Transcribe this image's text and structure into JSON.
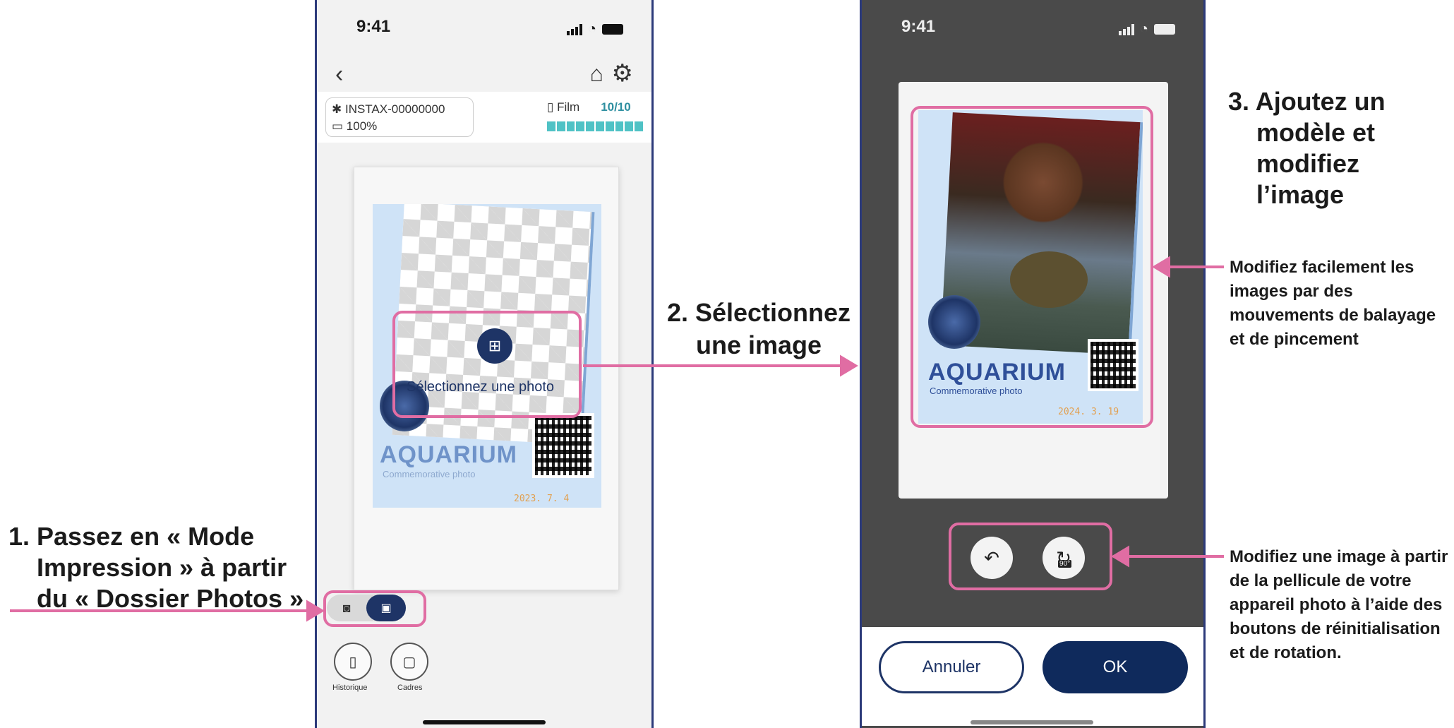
{
  "callouts": {
    "step1": [
      "1. Passez en « Mode",
      "Impression » à partir",
      "du « Dossier Photos »"
    ],
    "step2": [
      "2. Sélectionnez",
      "une image"
    ],
    "step3": [
      "3. Ajoutez un",
      "modèle et",
      "modifiez",
      "l’image"
    ],
    "note_swipe": "Modifiez facilement les images par des mouvements de balayage et de pincement",
    "note_buttons": "Modifiez une image à partir de la pellicule de votre appareil photo à l’aide des boutons de réinitialisation et de rotation."
  },
  "phone1": {
    "time": "9:41",
    "device_name": "INSTAX-00000000",
    "battery": "100%",
    "film_label": "Film",
    "film_count": "10/10",
    "select_photo": "Sélectionnez une photo",
    "template_title": "AQUARIUM",
    "template_subtitle": "Commemorative photo",
    "template_date": "2023. 7. 4",
    "history_label": "Historique",
    "frames_label": "Cadres",
    "icons": [
      "back-chevron-icon",
      "home-icon",
      "gear-icon",
      "bluetooth-icon",
      "battery-icon",
      "film-icon",
      "add-image-icon",
      "camera-icon",
      "image-icon",
      "phone-icon",
      "frame-icon"
    ]
  },
  "phone2": {
    "time": "9:41",
    "template_title": "AQUARIUM",
    "template_subtitle": "Commemorative photo",
    "template_date": "2024. 3. 19",
    "rotate_label": "90°",
    "cancel_label": "Annuler",
    "ok_label": "OK",
    "icons": [
      "reset-icon",
      "rotate-90-icon"
    ]
  },
  "colors": {
    "highlight": "#e06da3",
    "navy": "#1e3466",
    "film_teal": "#4fc2c5",
    "template_bg": "#cfe3f7"
  }
}
